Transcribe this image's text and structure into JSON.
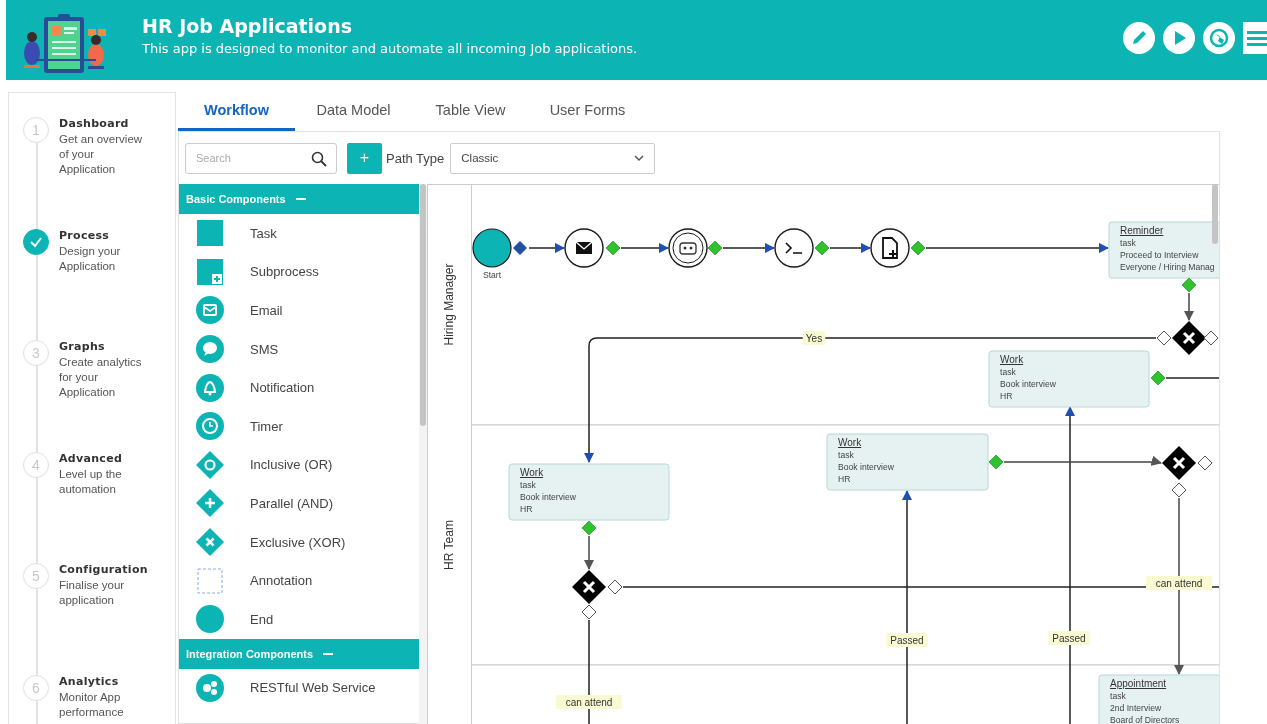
{
  "header": {
    "title": "HR Job Applications",
    "subtitle": "This app is designed to monitor and automate all incoming Job applications."
  },
  "steps": [
    {
      "number": "1",
      "title": "Dashboard",
      "description": "Get an overview of your Application",
      "done": false
    },
    {
      "title": "Process",
      "description": "Design your Application",
      "done": true
    },
    {
      "number": "3",
      "title": "Graphs",
      "description": "Create analytics for your Application",
      "done": false
    },
    {
      "number": "4",
      "title": "Advanced",
      "description": "Level up the automation",
      "done": false
    },
    {
      "number": "5",
      "title": "Configuration",
      "description": "Finalise your application",
      "done": false
    },
    {
      "number": "6",
      "title": "Analytics",
      "description": "Monitor App performance",
      "done": false
    }
  ],
  "tabs": [
    {
      "label": "Workflow",
      "selected": true
    },
    {
      "label": "Data Model",
      "selected": false
    },
    {
      "label": "Table View",
      "selected": false
    },
    {
      "label": "User Forms",
      "selected": false
    }
  ],
  "toolbar": {
    "search_placeholder": "Search",
    "add_button": "+",
    "path_type_label": "Path Type",
    "path_type_value": "Classic"
  },
  "palette": [
    {
      "title": "Basic Components",
      "expanded": true,
      "items": [
        {
          "kind": "task",
          "label": "Task"
        },
        {
          "kind": "subprocess",
          "label": "Subprocess"
        },
        {
          "kind": "email",
          "label": "Email"
        },
        {
          "kind": "sms",
          "label": "SMS"
        },
        {
          "kind": "notification",
          "label": "Notification"
        },
        {
          "kind": "timer",
          "label": "Timer"
        },
        {
          "kind": "inclusive",
          "label": "Inclusive (OR)"
        },
        {
          "kind": "parallel",
          "label": "Parallel (AND)"
        },
        {
          "kind": "exclusive",
          "label": "Exclusive (XOR)"
        },
        {
          "kind": "annotation",
          "label": "Annotation"
        },
        {
          "kind": "end",
          "label": "End"
        }
      ]
    },
    {
      "title": "Integration Components",
      "expanded": true,
      "items": [
        {
          "kind": "rest",
          "label": "RESTful Web Service"
        }
      ]
    }
  ],
  "diagram": {
    "lanes": [
      {
        "name": "Hiring Manager"
      },
      {
        "name": "HR Team"
      }
    ],
    "nodes": [
      {
        "kind": "start",
        "label": "Start"
      },
      {
        "kind": "email"
      },
      {
        "kind": "robot"
      },
      {
        "kind": "script"
      },
      {
        "kind": "document"
      },
      {
        "kind": "task",
        "title": "Reminder",
        "type": "task",
        "lines": [
          "Proceed to Interview",
          "Everyone / Hiring Manag"
        ]
      },
      {
        "kind": "gateway"
      },
      {
        "kind": "task",
        "title": "Work",
        "type": "task",
        "lines": [
          "Book interview",
          "HR"
        ]
      },
      {
        "kind": "task",
        "title": "Work",
        "type": "task",
        "lines": [
          "Book interview",
          "HR"
        ]
      },
      {
        "kind": "gateway"
      },
      {
        "kind": "task",
        "title": "Work",
        "type": "task",
        "lines": [
          "Book interview",
          "HR"
        ]
      },
      {
        "kind": "gateway"
      },
      {
        "kind": "task",
        "title": "Appointment",
        "type": "task",
        "lines": [
          "2nd Interview",
          "Board of Directors"
        ]
      }
    ],
    "edge_labels": [
      "Yes",
      "can attend",
      "Passed",
      "Passed",
      "can attend"
    ]
  }
}
